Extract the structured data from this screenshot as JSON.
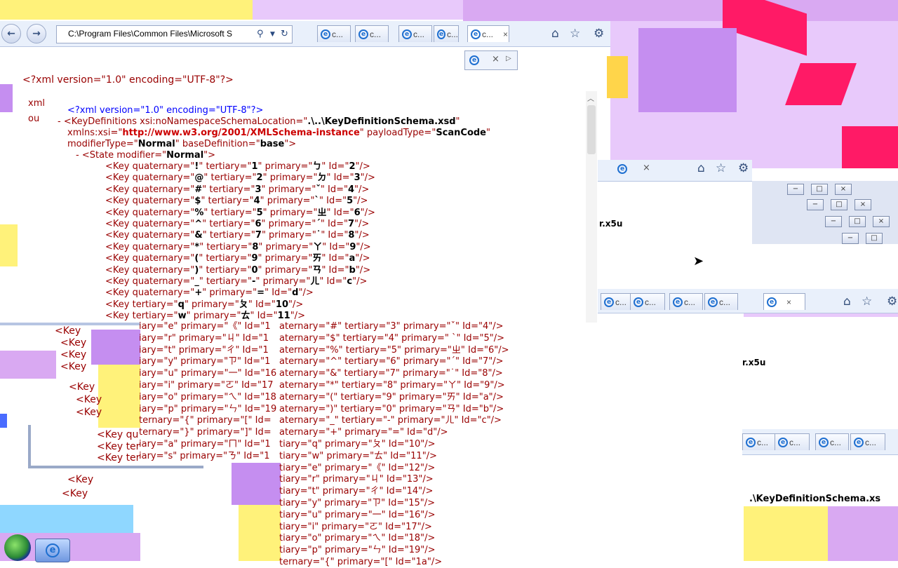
{
  "browser": {
    "address": "C:\\Program Files\\Common Files\\Microsoft S",
    "tabs": [
      "c...",
      "c...",
      "c...",
      "c...",
      "c..."
    ],
    "active_tab_close": "×",
    "nav_back": "←",
    "nav_forward": "→",
    "search_icon": "search-icon",
    "refresh_icon": "refresh-icon",
    "home_icon": "home-icon",
    "favorites_icon": "star-icon",
    "tools_icon": "gear-icon"
  },
  "xml": {
    "decl_outer": "<?xml version=\"1.0\" encoding=\"UTF-8\"?>",
    "decl_inner": "<?xml version=\"1.0\" encoding=\"UTF-8\"?>",
    "root_line1_prefix": "<KeyDefinitions xsi:noNamespaceSchemaLocation=\"",
    "root_line1_value": ".\\..\\KeyDefinitionSchema.xsd",
    "root_line2_prefix": "xmlns:xsi=\"",
    "root_line2_url": "http://www.w3.org/2001/XMLSchema-instance",
    "root_line2_mid": "\" payloadType=\"",
    "root_line2_val": "ScanCode",
    "root_line3_prefix": "modifierType=\"",
    "root_line3_val1": "Normal",
    "root_line3_mid": "\" baseDefinition=\"",
    "root_line3_val2": "base",
    "state_line": "- <State modifier=\"",
    "state_val": "Normal",
    "keys": [
      {
        "q": "!",
        "t": "1",
        "p": "ㄅ",
        "id": "2"
      },
      {
        "q": "@",
        "t": "2",
        "p": "ㄉ",
        "id": "3"
      },
      {
        "q": "#",
        "t": "3",
        "p": "ˇ",
        "id": "4"
      },
      {
        "q": "$",
        "t": "4",
        "p": "ˋ",
        "id": "5"
      },
      {
        "q": "%",
        "t": "5",
        "p": "ㄓ",
        "id": "6"
      },
      {
        "q": "^",
        "t": "6",
        "p": "ˊ",
        "id": "7"
      },
      {
        "q": "&",
        "t": "7",
        "p": "˙",
        "id": "8"
      },
      {
        "q": "*",
        "t": "8",
        "p": "ㄚ",
        "id": "9"
      },
      {
        "q": "(",
        "t": "9",
        "p": "ㄞ",
        "id": "a"
      },
      {
        "q": ")",
        "t": "0",
        "p": "ㄢ",
        "id": "b"
      },
      {
        "q": "_",
        "t": "-",
        "p": "ㄦ",
        "id": "c"
      },
      {
        "q": "+",
        "t": "",
        "p": "=",
        "id": "d"
      }
    ],
    "keys_tertiary": [
      {
        "t": "q",
        "p": "ㄆ",
        "id": "10"
      },
      {
        "t": "w",
        "p": "ㄊ",
        "id": "11"
      }
    ],
    "overlay_lines": [
      "iary=\"e\" primary=\"《\" Id=\"1",
      "iary=\"r\" primary=\"ㄐ\" Id=\"1",
      "iary=\"t\" primary=\"ㄔ\" Id=\"1",
      "iary=\"y\" primary=\"ㄗ\" Id=\"1",
      "iary=\"u\" primary=\"一\" Id=\"16",
      "iary=\"i\" primary=\"ㄛ\" Id=\"17",
      "iary=\"o\" primary=\"ㄟ\" Id=\"18",
      "iary=\"p\" primary=\"ㄣ\" Id=\"19",
      "ternary=\"{\" primary=\"[\" Id=",
      "ternary=\"}\" primary=\"]\" Id=",
      "iary=\"a\" primary=\"ㄇ\" Id=\"1",
      "iary=\"s\" primary=\"ㄋ\" Id=\"1"
    ],
    "right_lines": [
      "aternary=\"#\" tertiary=\"3\" primary=\"ˇ\" Id=\"4\"/>",
      "aternary=\"$\" tertiary=\"4\" primary=\" ˋ\" Id=\"5\"/>",
      "aternary=\"%\" tertiary=\"5\" primary=\"ㄓ\" Id=\"6\"/>",
      "aternary=\"^\" tertiary=\"6\" primary=\"ˊ\" Id=\"7\"/>",
      "aternary=\"&\" tertiary=\"7\" primary=\"˙\" Id=\"8\"/>",
      "aternary=\"*\" tertiary=\"8\" primary=\"ㄚ\" Id=\"9\"/>",
      "aternary=\"(\" tertiary=\"9\" primary=\"ㄞ\" Id=\"a\"/>",
      "aternary=\")\" tertiary=\"0\" primary=\"ㄢ\" Id=\"b\"/>",
      "aternary=\"_\" tertiary=\"-\" primary=\"ㄦ\" Id=\"c\"/>",
      "aternary=\"+\" primary=\"=\" Id=\"d\"/>",
      "tiary=\"q\" primary=\"ㄆ\" Id=\"10\"/>",
      "tiary=\"w\" primary=\"ㄊ\" Id=\"11\"/>",
      "tiary=\"e\" primary=\"《\" Id=\"12\"/>",
      "tiary=\"r\" primary=\"ㄐ\" Id=\"13\"/>",
      "tiary=\"t\" primary=\"ㄔ\" Id=\"14\"/>",
      "tiary=\"y\" primary=\"ㄗ\" Id=\"15\"/>",
      "tiary=\"u\" primary=\"一\" Id=\"16\"/>",
      "tiary=\"i\" primary=\"ㄛ\" Id=\"17\"/>",
      "tiary=\"o\" primary=\"ㄟ\" Id=\"18\"/>",
      "tiary=\"p\" primary=\"ㄣ\" Id=\"19\"/>",
      "ternary=\"{\" primary=\"[\" Id=\"1a\"/>"
    ],
    "left_fragments": [
      "<Key",
      "<Key",
      "<Key",
      "<Key",
      "<Key qu",
      "<Key ter",
      "<Key ter",
      "<Key",
      "<Key",
      "<Key",
      "<Key",
      "<Key"
    ],
    "side_fragment_1": "xml",
    "side_fragment_2": "ou",
    "side_fragment_3": "<Ke",
    "right_path_fragment": ".\\KeyDefinitionSchema.xs",
    "side_text_1": "r.x5u",
    "side_text_2": "r.x5u"
  },
  "colors": {
    "accent_pink": "#ff1a66",
    "lavender": "#d9a9f2",
    "yellow": "#fff27a",
    "xml_tag": "#990000",
    "xml_url": "#cc0000",
    "xml_pi": "#0000ff"
  }
}
